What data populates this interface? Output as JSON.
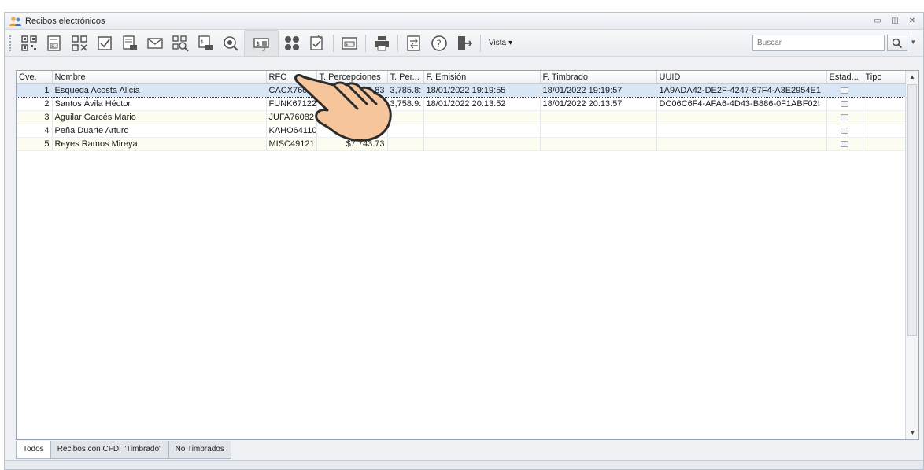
{
  "window": {
    "title": "Recibos electrónicos",
    "controls": [
      "minimize",
      "restore",
      "close"
    ]
  },
  "toolbar": {
    "buttons": [
      {
        "icon": "qr-code-icon"
      },
      {
        "icon": "receipt-money-icon"
      },
      {
        "icon": "qr-cancel-icon"
      },
      {
        "icon": "checkbox-icon"
      },
      {
        "icon": "print-receipt-icon"
      },
      {
        "icon": "envelope-icon"
      },
      {
        "icon": "qr-search-icon"
      },
      {
        "icon": "print-money-icon"
      },
      {
        "icon": "preview-icon"
      },
      {
        "icon": "money-stamp-icon"
      },
      {
        "icon": "group-dots-icon"
      },
      {
        "icon": "export-check-icon"
      },
      {
        "icon": "cash-icon"
      },
      {
        "icon": "printer-icon"
      },
      {
        "icon": "transfer-icon"
      },
      {
        "icon": "help-icon"
      },
      {
        "icon": "exit-door-icon"
      }
    ],
    "vista_label": "Vista",
    "search_placeholder": "Buscar",
    "search_icon": "search-icon"
  },
  "grid": {
    "columns": [
      "Cve.",
      "Nombre",
      "RFC",
      "T. Percepciones",
      "T. Per...",
      "F. Emisión",
      "F. Timbrado",
      "UUID",
      "Estad...",
      "Tipo"
    ],
    "rows": [
      {
        "cve": "1",
        "nombre": "Esqueda Acosta Alicia",
        "rfc": "CACX7605",
        "t_percepciones": "$3,785.83",
        "t_per": "3,785.8:",
        "f_emision": "18/01/2022 19:19:55",
        "f_timbrado": "18/01/2022 19:19:57",
        "uuid": "1A9ADA42-DE2F-4247-87F4-A3E2954E1",
        "estado_icon": "stamped-icon",
        "tipo": "",
        "selected": true
      },
      {
        "cve": "2",
        "nombre": "Santos Ávila Héctor",
        "rfc": "FUNK67122",
        "t_percepciones": "$3,758.92",
        "t_per": "3,758.9:",
        "f_emision": "18/01/2022 20:13:52",
        "f_timbrado": "18/01/2022 20:13:57",
        "uuid": "DC06C6F4-AFA6-4D43-B886-0F1ABF02!",
        "estado_icon": "stamped-icon",
        "tipo": "",
        "selected": false
      },
      {
        "cve": "3",
        "nombre": "Aguilar Garcés Mario",
        "rfc": "JUFA76082",
        "t_percepciones": "",
        "t_per": "",
        "f_emision": "",
        "f_timbrado": "",
        "uuid": "",
        "estado_icon": "pending-icon",
        "tipo": "",
        "selected": false
      },
      {
        "cve": "4",
        "nombre": "Peña Duarte Arturo",
        "rfc": "KAHO64110",
        "t_percepciones": "32",
        "t_per": "",
        "f_emision": "",
        "f_timbrado": "",
        "uuid": "",
        "estado_icon": "pending-icon",
        "tipo": "",
        "selected": false
      },
      {
        "cve": "5",
        "nombre": "Reyes Ramos Mireya",
        "rfc": "MISC49121",
        "t_percepciones": "$7,743.73",
        "t_per": "",
        "f_emision": "",
        "f_timbrado": "",
        "uuid": "",
        "estado_icon": "pending-icon",
        "tipo": "",
        "selected": false
      }
    ]
  },
  "tabs": [
    {
      "label": "Todos",
      "active": true
    },
    {
      "label": "Recibos con CFDI \"Timbrado\"",
      "active": false
    },
    {
      "label": "No Timbrados",
      "active": false
    }
  ],
  "colors": {
    "selected_row": "#d9e6f6",
    "alt_row": "#fdfcf0",
    "hand_fill": "#f6c59c"
  }
}
